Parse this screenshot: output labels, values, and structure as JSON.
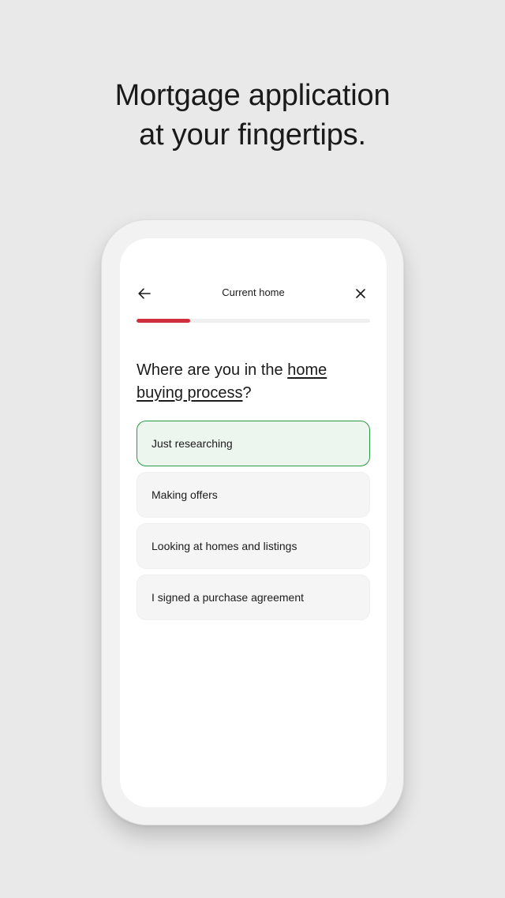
{
  "headline": {
    "line1": "Mortgage application",
    "line2": "at your fingertips."
  },
  "screen": {
    "title": "Current home",
    "back_icon": "arrow-left-icon",
    "close_icon": "close-icon",
    "progress": 0.23,
    "progress_color": "#d0303b",
    "question": {
      "part1": "Where are you in the ",
      "link": "home buying process",
      "part2": "?"
    },
    "options": [
      {
        "label": "Just researching",
        "selected": true
      },
      {
        "label": "Making offers",
        "selected": false
      },
      {
        "label": "Looking at homes and listings",
        "selected": false
      },
      {
        "label": "I signed a purchase agreement",
        "selected": false
      }
    ],
    "selected_color": "#2a9a48"
  }
}
